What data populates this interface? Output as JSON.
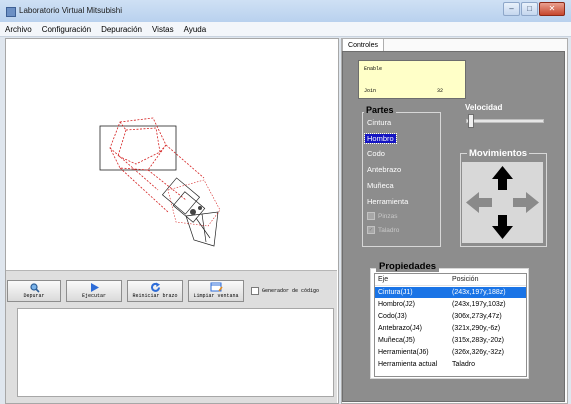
{
  "window": {
    "title": "Laboratorio Virtual Mitsubishi",
    "buttons": [
      "–",
      "□",
      "✕"
    ]
  },
  "menu": [
    "Archivo",
    "Configuración",
    "Depuración",
    "Vistas",
    "Ayuda"
  ],
  "toolbar": {
    "buttons": [
      {
        "label": "Depurar",
        "icon": "magnifier-icon"
      },
      {
        "label": "Ejecutar",
        "icon": "play-icon"
      },
      {
        "label": "Reiniciar brazo",
        "icon": "refresh-icon"
      },
      {
        "label": "Limpiar ventana",
        "icon": "clear-window-icon"
      }
    ],
    "generator_checkbox": "Generador de código"
  },
  "tabs": [
    "Controles"
  ],
  "console": {
    "line1": "Enable",
    "join_label": "Join",
    "join_value": "32"
  },
  "partes": {
    "title": "Partes",
    "items": [
      "Cintura",
      "Hombro",
      "Codo",
      "Antebrazo",
      "Muñeca",
      "Herramienta"
    ],
    "selected": "Hombro",
    "sub_options": [
      {
        "label": "Pinzas",
        "checked": false
      },
      {
        "label": "Taladro",
        "checked": true
      }
    ]
  },
  "velocidad": {
    "label": "Velocidad",
    "value_fraction": 0.02
  },
  "movimientos": {
    "title": "Movimientos",
    "arrows": [
      "up-arrow-icon",
      "left-arrow-icon",
      "right-arrow-icon",
      "down-arrow-icon"
    ]
  },
  "propiedades": {
    "title": "Propiedades",
    "headers": [
      "Eje",
      "Posición"
    ],
    "rows": [
      [
        "Cintura(J1)",
        "(243x,197y,188z)"
      ],
      [
        "Hombro(J2)",
        "(243x,197y,103z)"
      ],
      [
        "Codo(J3)",
        "(306x,273y,47z)"
      ],
      [
        "Antebrazo(J4)",
        "(321x,290y,-6z)"
      ],
      [
        "Muñeca(J5)",
        "(315x,283y,-20z)"
      ],
      [
        "Herramienta(J6)",
        "(326x,326y,-32z)"
      ],
      [
        "Herramienta actual",
        "Taladro"
      ]
    ],
    "selected_row": 0
  },
  "colors": {
    "panel": "#8d8d8d",
    "console_bg": "#ffffc8",
    "selection": "#1a74e6",
    "partes_selection": "#1313c2",
    "robot_wire": "#d42020"
  }
}
